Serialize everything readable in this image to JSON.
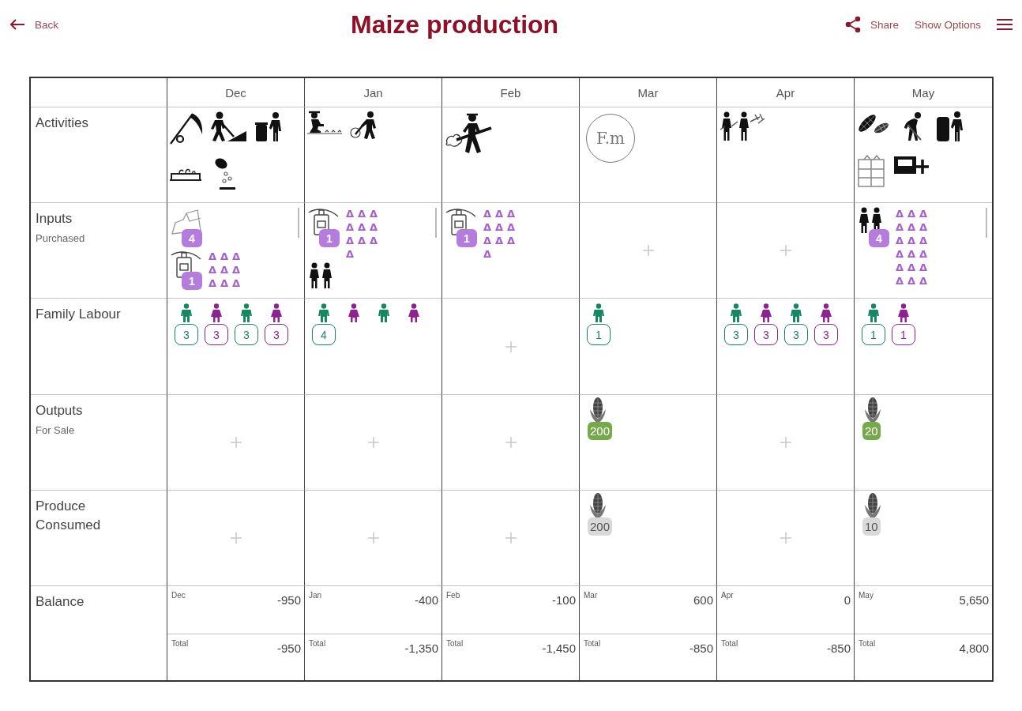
{
  "header": {
    "back": "Back",
    "title": "Maize production",
    "share": "Share",
    "options": "Show Options"
  },
  "table": {
    "months": [
      "Dec",
      "Jan",
      "Feb",
      "Mar",
      "Apr",
      "May"
    ],
    "rows": [
      {
        "kind": "activities",
        "label": "Activities",
        "cells": [
          {
            "items": [
              {
                "kind": "scythe"
              },
              {
                "kind": "digger"
              },
              {
                "kind": "bin"
              },
              {
                "kind": "tray"
              },
              {
                "kind": "sowing"
              }
            ]
          },
          {
            "items": [
              {
                "kind": "planter"
              },
              {
                "kind": "raker"
              }
            ]
          },
          {
            "items": [
              {
                "kind": "shoveler"
              }
            ]
          },
          {
            "items": [
              {
                "kind": "text",
                "label": "F.m"
              }
            ]
          },
          {
            "items": [
              {
                "kind": "pair"
              }
            ]
          },
          {
            "items": [
              {
                "kind": "cobs"
              },
              {
                "kind": "bender"
              },
              {
                "kind": "carrier"
              },
              {
                "kind": "crates"
              },
              {
                "kind": "boxplus"
              }
            ]
          }
        ]
      },
      {
        "kind": "inputs",
        "label": "Inputs",
        "sublabel": "Purchased",
        "cells": [
          {
            "scrollable": true,
            "items": [
              {
                "kind": "bag",
                "count": "4"
              },
              {
                "kind": "sprayer",
                "count": "1",
                "markers": "ΔΔΔΔΔΔΔΔΔ"
              }
            ]
          },
          {
            "scrollable": true,
            "items": [
              {
                "kind": "sprayer",
                "count": "1",
                "markers": "ΔΔΔΔΔΔΔΔΔΔ"
              },
              {
                "kind": "workers"
              }
            ]
          },
          {
            "scrollable": false,
            "items": [
              {
                "kind": "sprayer",
                "count": "1",
                "markers": "ΔΔΔΔΔΔΔΔΔΔ"
              }
            ]
          },
          {
            "scrollable": false
          },
          {
            "scrollable": false
          },
          {
            "scrollable": true,
            "items": [
              {
                "kind": "workers",
                "count": "4",
                "markers": "ΔΔΔΔΔΔΔΔΔΔΔΔΔΔΔΔΔΔ"
              }
            ]
          }
        ]
      },
      {
        "kind": "labour",
        "label": "Family Labour",
        "cells": [
          {
            "items": [
              {
                "kind": "man",
                "color": "#17875f",
                "count": "3"
              },
              {
                "kind": "woman",
                "color": "#8e2290",
                "count": "3"
              },
              {
                "kind": "man",
                "color": "#17875f",
                "count": "3"
              },
              {
                "kind": "woman",
                "color": "#8e2290",
                "count": "3"
              }
            ]
          },
          {
            "items": [
              {
                "kind": "man",
                "color": "#17875f",
                "count": "4"
              },
              {
                "kind": "woman",
                "color": "#8e2290"
              },
              {
                "kind": "man",
                "color": "#17875f"
              },
              {
                "kind": "woman",
                "color": "#8e2290"
              }
            ]
          },
          {},
          {
            "items": [
              {
                "kind": "man",
                "color": "#17875f",
                "count": "1"
              }
            ]
          },
          {
            "items": [
              {
                "kind": "man",
                "color": "#17875f",
                "count": "3"
              },
              {
                "kind": "woman",
                "color": "#8e2290",
                "count": "3"
              },
              {
                "kind": "man",
                "color": "#17875f",
                "count": "3"
              },
              {
                "kind": "woman",
                "color": "#8e2290",
                "count": "3"
              }
            ]
          },
          {
            "items": [
              {
                "kind": "man",
                "color": "#17875f",
                "count": "1"
              },
              {
                "kind": "woman",
                "color": "#8e2290",
                "count": "1"
              }
            ]
          }
        ]
      },
      {
        "kind": "outputs",
        "label": "Outputs",
        "sublabel": "For Sale",
        "cells": [
          {},
          {},
          {},
          {
            "items": [
              {
                "kind": "maize",
                "count": "200"
              }
            ]
          },
          {},
          {
            "items": [
              {
                "kind": "maize",
                "count": "20"
              }
            ]
          }
        ]
      },
      {
        "kind": "consumed",
        "label": "Produce Consumed",
        "cells": [
          {},
          {},
          {},
          {
            "items": [
              {
                "kind": "maize",
                "count": "200"
              }
            ]
          },
          {},
          {
            "items": [
              {
                "kind": "maize",
                "count": "10"
              }
            ]
          }
        ]
      },
      {
        "kind": "balance",
        "label": "Balance",
        "cells": [
          {
            "month": "Dec",
            "value": "-950",
            "total_label": "Total",
            "total": "-950"
          },
          {
            "month": "Jan",
            "value": "-400",
            "total_label": "Total",
            "total": "-1,350"
          },
          {
            "month": "Feb",
            "value": "-100",
            "total_label": "Total",
            "total": "-1,450"
          },
          {
            "month": "Mar",
            "value": "600",
            "total_label": "Total",
            "total": "-850"
          },
          {
            "month": "Apr",
            "value": "0",
            "total_label": "Total",
            "total": "-850"
          },
          {
            "month": "May",
            "value": "5,650",
            "total_label": "Total",
            "total": "4,800"
          }
        ]
      }
    ]
  }
}
